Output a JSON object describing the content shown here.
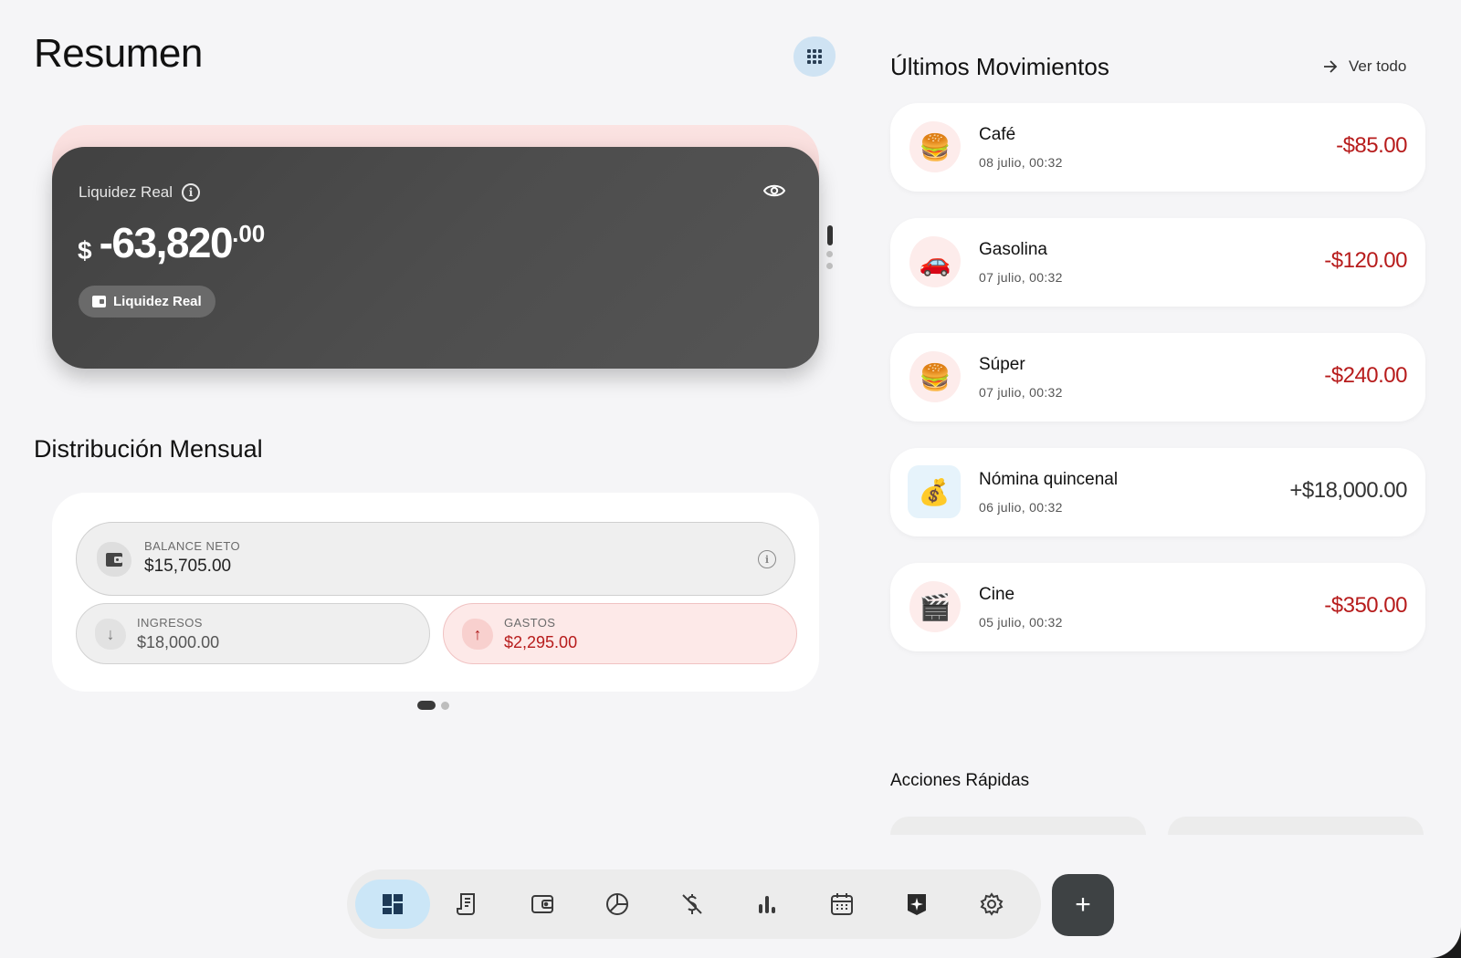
{
  "header": {
    "title": "Resumen"
  },
  "balance_card": {
    "label": "Liquidez Real",
    "currency": "$",
    "amount_int": "-63,820",
    "amount_dec": ".00",
    "chip_label": "Liquidez Real"
  },
  "distribution": {
    "title": "Distribución Mensual",
    "balance": {
      "label": "BALANCE NETO",
      "value": "$15,705.00"
    },
    "income": {
      "label": "INGRESOS",
      "value": "$18,000.00"
    },
    "expenses": {
      "label": "GASTOS",
      "value": "$2,295.00"
    }
  },
  "movements": {
    "title": "Últimos Movimientos",
    "see_all": "Ver todo",
    "items": [
      {
        "icon": "🍔",
        "name": "Café",
        "date": "08 julio, 00:32",
        "amount": "-$85.00",
        "type": "expense"
      },
      {
        "icon": "🚗",
        "name": "Gasolina",
        "date": "07 julio, 00:32",
        "amount": "-$120.00",
        "type": "expense"
      },
      {
        "icon": "🍔",
        "name": "Súper",
        "date": "07 julio, 00:32",
        "amount": "-$240.00",
        "type": "expense"
      },
      {
        "icon": "💰",
        "name": "Nómina quincenal",
        "date": "06 julio, 00:32",
        "amount": "+$18,000.00",
        "type": "income"
      },
      {
        "icon": "🎬",
        "name": "Cine",
        "date": "05 julio, 00:32",
        "amount": "-$350.00",
        "type": "expense"
      }
    ]
  },
  "quick_actions": {
    "title": "Acciones Rápidas"
  },
  "nav": {
    "items": [
      "dashboard-icon",
      "receipt-icon",
      "wallet-icon",
      "pie-chart-icon",
      "no-money-icon",
      "bar-chart-icon",
      "calendar-icon",
      "sparkle-icon",
      "settings-icon"
    ],
    "active": "dashboard-icon",
    "fab_label": "+"
  },
  "colors": {
    "expense": "#b71c1c",
    "accent": "#cbe6f7",
    "card_dark": "#4a4a4a"
  }
}
